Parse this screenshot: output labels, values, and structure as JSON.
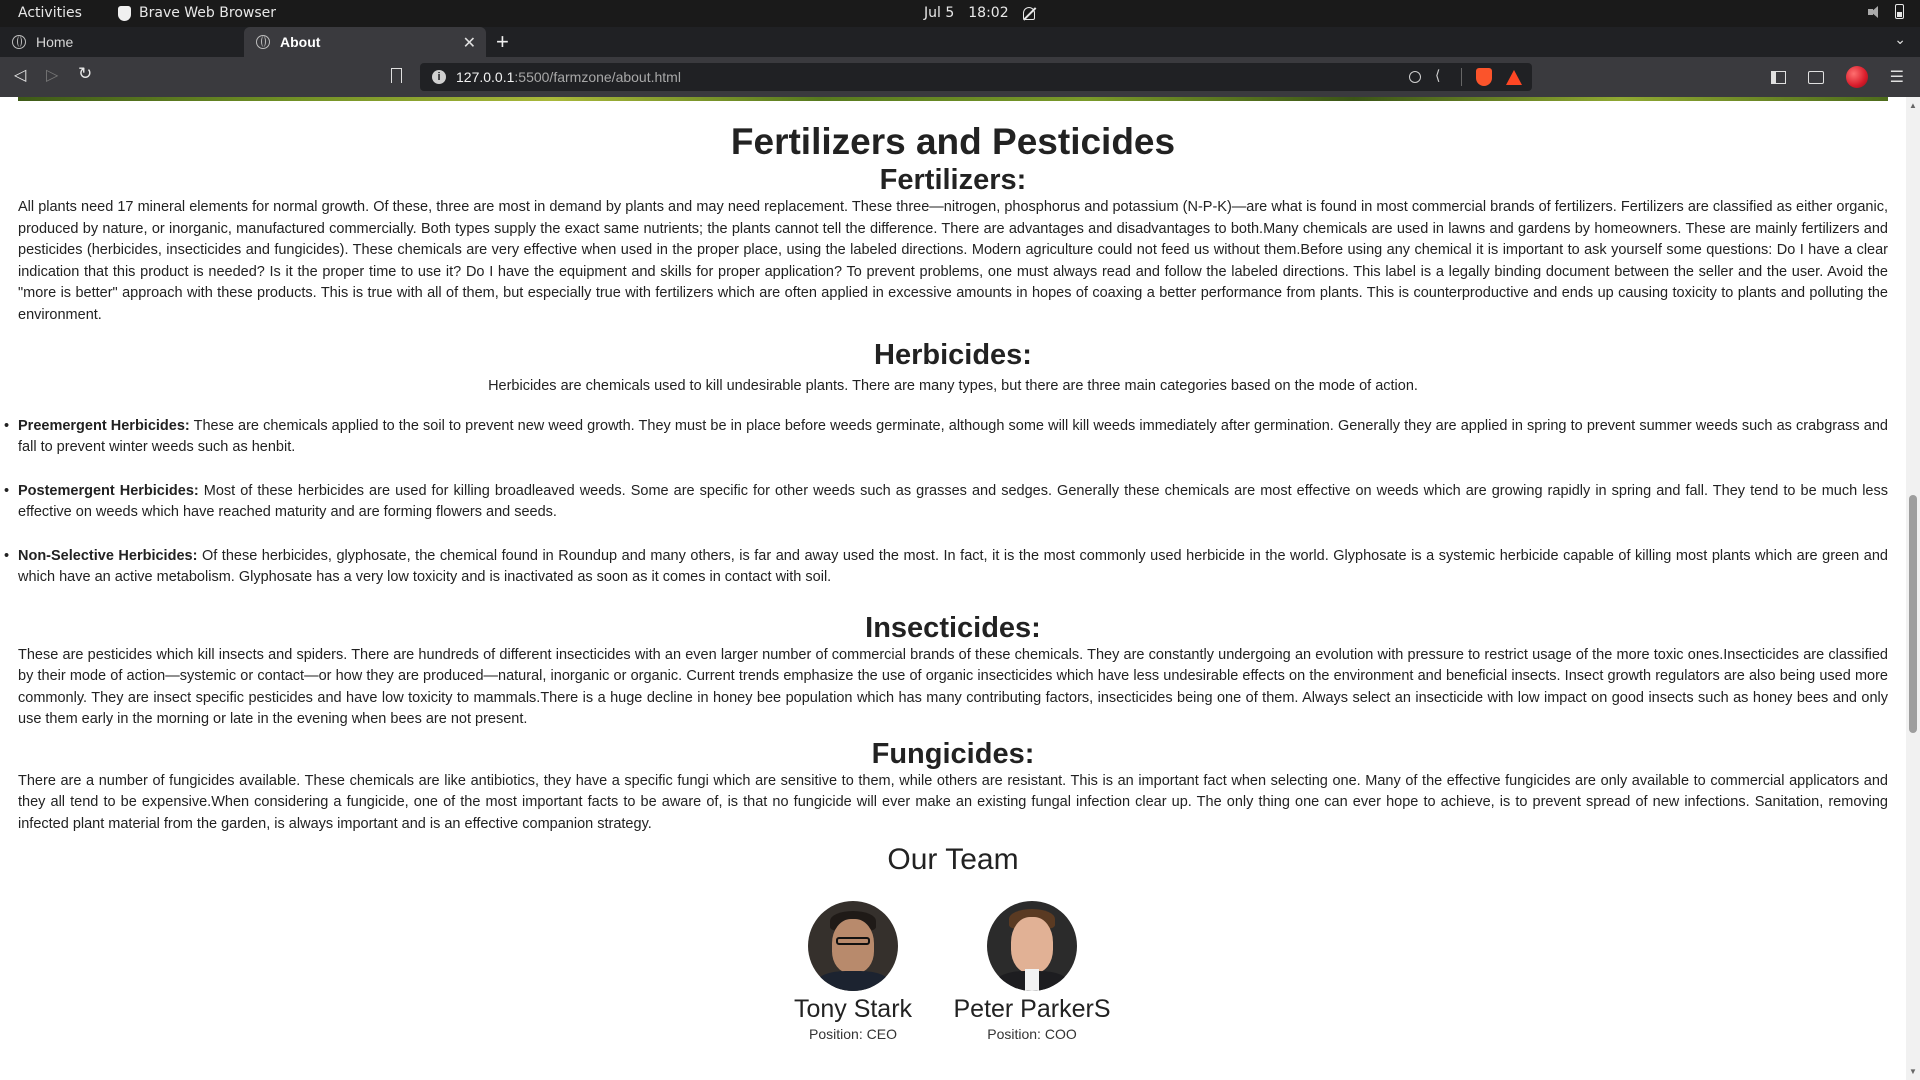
{
  "system": {
    "activities": "Activities",
    "app_name": "Brave Web Browser",
    "date": "Jul 5",
    "time": "18:02"
  },
  "tabs": [
    {
      "label": "Home",
      "active": false
    },
    {
      "label": "About",
      "active": true
    }
  ],
  "toolbar": {
    "url_host": "127.0.0.1",
    "url_path": ":5500/farmzone/about.html"
  },
  "page": {
    "title": "Fertilizers and Pesticides",
    "fertilizers": {
      "heading": "Fertilizers:",
      "text": "All plants need 17 mineral elements for normal growth. Of these, three are most in demand by plants and may need replacement. These three—nitrogen, phosphorus and potassium (N-P-K)—are what is found in most commercial brands of fertilizers. Fertilizers are classified as either organic, produced by nature, or inorganic, manufactured commercially. Both types supply the exact same nutrients; the plants cannot tell the difference. There are advantages and disadvantages to both.Many chemicals are used in lawns and gardens by homeowners. These are mainly fertilizers and pesticides (herbicides, insecticides and fungicides). These chemicals are very effective when used in the proper place, using the labeled directions. Modern agriculture could not feed us without them.Before using any chemical it is important to ask yourself some questions: Do I have a clear indication that this product is needed? Is it the proper time to use it? Do I have the equipment and skills for proper application? To prevent problems, one must always read and follow the labeled directions. This label is a legally binding document between the seller and the user. Avoid the \"more is better\" approach with these products. This is true with all of them, but especially true with fertilizers which are often applied in excessive amounts in hopes of coaxing a better performance from plants. This is counterproductive and ends up causing toxicity to plants and polluting the environment."
    },
    "herbicides": {
      "heading": "Herbicides:",
      "intro": "Herbicides are chemicals used to kill undesirable plants. There are many types, but there are three main categories based on the mode of action.",
      "items": [
        {
          "term": "Preemergent Herbicides:",
          "text": " These are chemicals applied to the soil to prevent new weed growth. They must be in place before weeds germinate, although some will kill weeds immediately after germination. Generally they are applied in spring to prevent summer weeds such as crabgrass and fall to prevent winter weeds such as henbit."
        },
        {
          "term": "Postemergent Herbicides:",
          "text": " Most of these herbicides are used for killing broadleaved weeds. Some are specific for other weeds such as grasses and sedges. Generally these chemicals are most effective on weeds which are growing rapidly in spring and fall. They tend to be much less effective on weeds which have reached maturity and are forming flowers and seeds."
        },
        {
          "term": "Non-Selective Herbicides:",
          "text": " Of these herbicides, glyphosate, the chemical found in Roundup and many others, is far and away used the most. In fact, it is the most commonly used herbicide in the world. Glyphosate is a systemic herbicide capable of killing most plants which are green and which have an active metabolism. Glyphosate has a very low toxicity and is inactivated as soon as it comes in contact with soil."
        }
      ]
    },
    "insecticides": {
      "heading": "Insecticides:",
      "text": "These are pesticides which kill insects and spiders. There are hundreds of different insecticides with an even larger number of commercial brands of these chemicals. They are constantly undergoing an evolution with pressure to restrict usage of the more toxic ones.Insecticides are classified by their mode of action—systemic or contact—or how they are produced—natural, inorganic or organic. Current trends emphasize the use of organic insecticides which have less undesirable effects on the environment and beneficial insects. Insect growth regulators are also being used more commonly. They are insect specific pesticides and have low toxicity to mammals.There is a huge decline in honey bee population which has many contributing factors, insecticides being one of them. Always select an insecticide with low impact on good insects such as honey bees and only use them early in the morning or late in the evening when bees are not present."
    },
    "fungicides": {
      "heading": "Fungicides:",
      "text": "There are a number of fungicides available. These chemicals are like antibiotics, they have a specific fungi which are sensitive to them, while others are resistant. This is an important fact when selecting one. Many of the effective fungicides are only available to commercial applicators and they all tend to be expensive.When considering a fungicide, one of the most important facts to be aware of, is that no fungicide will ever make an existing fungal infection clear up. The only thing one can ever hope to achieve, is to prevent spread of new infections. Sanitation, removing infected plant material from the garden, is always important and is an effective companion strategy."
    },
    "team": {
      "heading": "Our Team",
      "members": [
        {
          "name": "Tony Stark",
          "position": "Position: CEO"
        },
        {
          "name": "Peter ParkerS",
          "position": "Position: COO"
        }
      ]
    }
  }
}
